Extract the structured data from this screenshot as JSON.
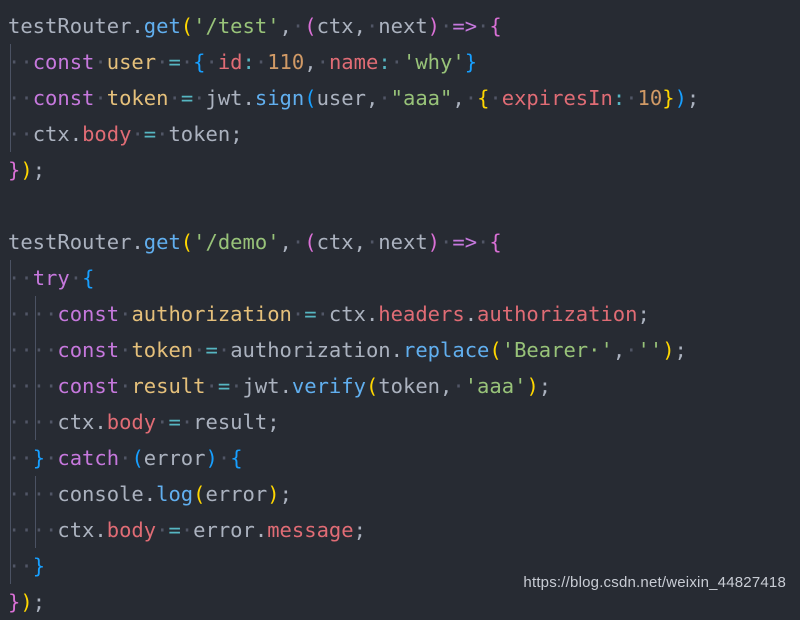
{
  "editor": {
    "background": "#272b33",
    "foreground": "#abb2bf",
    "language": "javascript",
    "indent_guide_color": "#4b5263",
    "whitespace_dot_color": "#515666"
  },
  "colors": {
    "keyword": "#c678dd",
    "function": "#61afef",
    "property": "#e06c75",
    "string": "#98c379",
    "number": "#d19a66",
    "variable_def": "#e5c07b",
    "operator": "#56b6c2",
    "bracket_gold": "#ffd700",
    "bracket_magenta": "#da70d6",
    "bracket_blue": "#179fff"
  },
  "watermark": {
    "text": "https://blog.csdn.net/weixin_44827418"
  },
  "code": {
    "lines": [
      {
        "index": 1,
        "text": "testRouter.get('/test', (ctx, next) => {",
        "tokens": [
          {
            "t": "testRouter",
            "c": "t-var"
          },
          {
            "t": ".",
            "c": "t-punct"
          },
          {
            "t": "get",
            "c": "t-fn"
          },
          {
            "t": "(",
            "c": "by"
          },
          {
            "t": "'/test'",
            "c": "t-str"
          },
          {
            "t": ",",
            "c": "t-punct"
          },
          {
            "t": "·",
            "c": "ws"
          },
          {
            "t": "(",
            "c": "bm"
          },
          {
            "t": "ctx",
            "c": "t-var"
          },
          {
            "t": ",",
            "c": "t-punct"
          },
          {
            "t": "·",
            "c": "ws"
          },
          {
            "t": "next",
            "c": "t-var"
          },
          {
            "t": ")",
            "c": "bm"
          },
          {
            "t": "·",
            "c": "ws"
          },
          {
            "t": "=>",
            "c": "t-arrow"
          },
          {
            "t": "·",
            "c": "ws"
          },
          {
            "t": "{",
            "c": "bm"
          }
        ]
      },
      {
        "index": 2,
        "text": "  const user = { id: 110, name: 'why'}",
        "tokens": [
          {
            "t": "·",
            "c": "ws"
          },
          {
            "t": "·",
            "c": "ws"
          },
          {
            "t": "const",
            "c": "t-kw"
          },
          {
            "t": "·",
            "c": "ws"
          },
          {
            "t": "user",
            "c": "t-def"
          },
          {
            "t": "·",
            "c": "ws"
          },
          {
            "t": "=",
            "c": "t-op"
          },
          {
            "t": "·",
            "c": "ws"
          },
          {
            "t": "{",
            "c": "bb"
          },
          {
            "t": "·",
            "c": "ws"
          },
          {
            "t": "id",
            "c": "t-prop"
          },
          {
            "t": ":",
            "c": "t-op"
          },
          {
            "t": "·",
            "c": "ws"
          },
          {
            "t": "110",
            "c": "t-num"
          },
          {
            "t": ",",
            "c": "t-punct"
          },
          {
            "t": "·",
            "c": "ws"
          },
          {
            "t": "name",
            "c": "t-prop"
          },
          {
            "t": ":",
            "c": "t-op"
          },
          {
            "t": "·",
            "c": "ws"
          },
          {
            "t": "'why'",
            "c": "t-str"
          },
          {
            "t": "}",
            "c": "bb"
          }
        ]
      },
      {
        "index": 3,
        "text": "  const token = jwt.sign(user, \"aaa\", { expiresIn: 10});",
        "tokens": [
          {
            "t": "·",
            "c": "ws"
          },
          {
            "t": "·",
            "c": "ws"
          },
          {
            "t": "const",
            "c": "t-kw"
          },
          {
            "t": "·",
            "c": "ws"
          },
          {
            "t": "token",
            "c": "t-def"
          },
          {
            "t": "·",
            "c": "ws"
          },
          {
            "t": "=",
            "c": "t-op"
          },
          {
            "t": "·",
            "c": "ws"
          },
          {
            "t": "jwt",
            "c": "t-var"
          },
          {
            "t": ".",
            "c": "t-punct"
          },
          {
            "t": "sign",
            "c": "t-fn"
          },
          {
            "t": "(",
            "c": "bb"
          },
          {
            "t": "user",
            "c": "t-var"
          },
          {
            "t": ",",
            "c": "t-punct"
          },
          {
            "t": "·",
            "c": "ws"
          },
          {
            "t": "\"aaa\"",
            "c": "t-str"
          },
          {
            "t": ",",
            "c": "t-punct"
          },
          {
            "t": "·",
            "c": "ws"
          },
          {
            "t": "{",
            "c": "by"
          },
          {
            "t": "·",
            "c": "ws"
          },
          {
            "t": "expiresIn",
            "c": "t-prop"
          },
          {
            "t": ":",
            "c": "t-op"
          },
          {
            "t": "·",
            "c": "ws"
          },
          {
            "t": "10",
            "c": "t-num"
          },
          {
            "t": "}",
            "c": "by"
          },
          {
            "t": ")",
            "c": "bb"
          },
          {
            "t": ";",
            "c": "t-punct"
          }
        ]
      },
      {
        "index": 4,
        "text": "  ctx.body = token;",
        "tokens": [
          {
            "t": "·",
            "c": "ws"
          },
          {
            "t": "·",
            "c": "ws"
          },
          {
            "t": "ctx",
            "c": "t-var"
          },
          {
            "t": ".",
            "c": "t-punct"
          },
          {
            "t": "body",
            "c": "t-prop"
          },
          {
            "t": "·",
            "c": "ws"
          },
          {
            "t": "=",
            "c": "t-op"
          },
          {
            "t": "·",
            "c": "ws"
          },
          {
            "t": "token",
            "c": "t-var"
          },
          {
            "t": ";",
            "c": "t-punct"
          }
        ]
      },
      {
        "index": 5,
        "text": "});",
        "tokens": [
          {
            "t": "}",
            "c": "bm"
          },
          {
            "t": ")",
            "c": "by"
          },
          {
            "t": ";",
            "c": "t-punct"
          }
        ]
      },
      {
        "index": 6,
        "text": "",
        "tokens": []
      },
      {
        "index": 7,
        "text": "testRouter.get('/demo', (ctx, next) => {",
        "tokens": [
          {
            "t": "testRouter",
            "c": "t-var"
          },
          {
            "t": ".",
            "c": "t-punct"
          },
          {
            "t": "get",
            "c": "t-fn"
          },
          {
            "t": "(",
            "c": "by"
          },
          {
            "t": "'/demo'",
            "c": "t-str"
          },
          {
            "t": ",",
            "c": "t-punct"
          },
          {
            "t": "·",
            "c": "ws"
          },
          {
            "t": "(",
            "c": "bm"
          },
          {
            "t": "ctx",
            "c": "t-var"
          },
          {
            "t": ",",
            "c": "t-punct"
          },
          {
            "t": "·",
            "c": "ws"
          },
          {
            "t": "next",
            "c": "t-var"
          },
          {
            "t": ")",
            "c": "bm"
          },
          {
            "t": "·",
            "c": "ws"
          },
          {
            "t": "=>",
            "c": "t-arrow"
          },
          {
            "t": "·",
            "c": "ws"
          },
          {
            "t": "{",
            "c": "bm"
          }
        ]
      },
      {
        "index": 8,
        "text": "  try {",
        "tokens": [
          {
            "t": "·",
            "c": "ws"
          },
          {
            "t": "·",
            "c": "ws"
          },
          {
            "t": "try",
            "c": "t-kw"
          },
          {
            "t": "·",
            "c": "ws"
          },
          {
            "t": "{",
            "c": "bb"
          }
        ]
      },
      {
        "index": 9,
        "text": "    const authorization = ctx.headers.authorization;",
        "tokens": [
          {
            "t": "·",
            "c": "ws"
          },
          {
            "t": "·",
            "c": "ws"
          },
          {
            "t": "·",
            "c": "ws"
          },
          {
            "t": "·",
            "c": "ws"
          },
          {
            "t": "const",
            "c": "t-kw"
          },
          {
            "t": "·",
            "c": "ws"
          },
          {
            "t": "authorization",
            "c": "t-def"
          },
          {
            "t": "·",
            "c": "ws"
          },
          {
            "t": "=",
            "c": "t-op"
          },
          {
            "t": "·",
            "c": "ws"
          },
          {
            "t": "ctx",
            "c": "t-var"
          },
          {
            "t": ".",
            "c": "t-punct"
          },
          {
            "t": "headers",
            "c": "t-prop"
          },
          {
            "t": ".",
            "c": "t-punct"
          },
          {
            "t": "authorization",
            "c": "t-prop"
          },
          {
            "t": ";",
            "c": "t-punct"
          }
        ]
      },
      {
        "index": 10,
        "text": "    const token = authorization.replace('Bearer ', '');",
        "tokens": [
          {
            "t": "·",
            "c": "ws"
          },
          {
            "t": "·",
            "c": "ws"
          },
          {
            "t": "·",
            "c": "ws"
          },
          {
            "t": "·",
            "c": "ws"
          },
          {
            "t": "const",
            "c": "t-kw"
          },
          {
            "t": "·",
            "c": "ws"
          },
          {
            "t": "token",
            "c": "t-def"
          },
          {
            "t": "·",
            "c": "ws"
          },
          {
            "t": "=",
            "c": "t-op"
          },
          {
            "t": "·",
            "c": "ws"
          },
          {
            "t": "authorization",
            "c": "t-var"
          },
          {
            "t": ".",
            "c": "t-punct"
          },
          {
            "t": "replace",
            "c": "t-fn"
          },
          {
            "t": "(",
            "c": "by"
          },
          {
            "t": "'Bearer·'",
            "c": "t-str"
          },
          {
            "t": ",",
            "c": "t-punct"
          },
          {
            "t": "·",
            "c": "ws"
          },
          {
            "t": "''",
            "c": "t-str"
          },
          {
            "t": ")",
            "c": "by"
          },
          {
            "t": ";",
            "c": "t-punct"
          }
        ]
      },
      {
        "index": 11,
        "text": "    const result = jwt.verify(token, 'aaa');",
        "tokens": [
          {
            "t": "·",
            "c": "ws"
          },
          {
            "t": "·",
            "c": "ws"
          },
          {
            "t": "·",
            "c": "ws"
          },
          {
            "t": "·",
            "c": "ws"
          },
          {
            "t": "const",
            "c": "t-kw"
          },
          {
            "t": "·",
            "c": "ws"
          },
          {
            "t": "result",
            "c": "t-def"
          },
          {
            "t": "·",
            "c": "ws"
          },
          {
            "t": "=",
            "c": "t-op"
          },
          {
            "t": "·",
            "c": "ws"
          },
          {
            "t": "jwt",
            "c": "t-var"
          },
          {
            "t": ".",
            "c": "t-punct"
          },
          {
            "t": "verify",
            "c": "t-fn"
          },
          {
            "t": "(",
            "c": "by"
          },
          {
            "t": "token",
            "c": "t-var"
          },
          {
            "t": ",",
            "c": "t-punct"
          },
          {
            "t": "·",
            "c": "ws"
          },
          {
            "t": "'aaa'",
            "c": "t-str"
          },
          {
            "t": ")",
            "c": "by"
          },
          {
            "t": ";",
            "c": "t-punct"
          }
        ]
      },
      {
        "index": 12,
        "text": "    ctx.body = result;",
        "tokens": [
          {
            "t": "·",
            "c": "ws"
          },
          {
            "t": "·",
            "c": "ws"
          },
          {
            "t": "·",
            "c": "ws"
          },
          {
            "t": "·",
            "c": "ws"
          },
          {
            "t": "ctx",
            "c": "t-var"
          },
          {
            "t": ".",
            "c": "t-punct"
          },
          {
            "t": "body",
            "c": "t-prop"
          },
          {
            "t": "·",
            "c": "ws"
          },
          {
            "t": "=",
            "c": "t-op"
          },
          {
            "t": "·",
            "c": "ws"
          },
          {
            "t": "result",
            "c": "t-var"
          },
          {
            "t": ";",
            "c": "t-punct"
          }
        ]
      },
      {
        "index": 13,
        "text": "  } catch (error) {",
        "tokens": [
          {
            "t": "·",
            "c": "ws"
          },
          {
            "t": "·",
            "c": "ws"
          },
          {
            "t": "}",
            "c": "bb"
          },
          {
            "t": "·",
            "c": "ws"
          },
          {
            "t": "catch",
            "c": "t-kw"
          },
          {
            "t": "·",
            "c": "ws"
          },
          {
            "t": "(",
            "c": "bb"
          },
          {
            "t": "error",
            "c": "t-var"
          },
          {
            "t": ")",
            "c": "bb"
          },
          {
            "t": "·",
            "c": "ws"
          },
          {
            "t": "{",
            "c": "bb"
          }
        ]
      },
      {
        "index": 14,
        "text": "    console.log(error);",
        "tokens": [
          {
            "t": "·",
            "c": "ws"
          },
          {
            "t": "·",
            "c": "ws"
          },
          {
            "t": "·",
            "c": "ws"
          },
          {
            "t": "·",
            "c": "ws"
          },
          {
            "t": "console",
            "c": "t-var"
          },
          {
            "t": ".",
            "c": "t-punct"
          },
          {
            "t": "log",
            "c": "t-fn"
          },
          {
            "t": "(",
            "c": "by"
          },
          {
            "t": "error",
            "c": "t-var"
          },
          {
            "t": ")",
            "c": "by"
          },
          {
            "t": ";",
            "c": "t-punct"
          }
        ]
      },
      {
        "index": 15,
        "text": "    ctx.body = error.message;",
        "tokens": [
          {
            "t": "·",
            "c": "ws"
          },
          {
            "t": "·",
            "c": "ws"
          },
          {
            "t": "·",
            "c": "ws"
          },
          {
            "t": "·",
            "c": "ws"
          },
          {
            "t": "ctx",
            "c": "t-var"
          },
          {
            "t": ".",
            "c": "t-punct"
          },
          {
            "t": "body",
            "c": "t-prop"
          },
          {
            "t": "·",
            "c": "ws"
          },
          {
            "t": "=",
            "c": "t-op"
          },
          {
            "t": "·",
            "c": "ws"
          },
          {
            "t": "error",
            "c": "t-var"
          },
          {
            "t": ".",
            "c": "t-punct"
          },
          {
            "t": "message",
            "c": "t-prop"
          },
          {
            "t": ";",
            "c": "t-punct"
          }
        ]
      },
      {
        "index": 16,
        "text": "  }",
        "tokens": [
          {
            "t": "·",
            "c": "ws"
          },
          {
            "t": "·",
            "c": "ws"
          },
          {
            "t": "}",
            "c": "bb"
          }
        ]
      },
      {
        "index": 17,
        "text": "});",
        "tokens": [
          {
            "t": "}",
            "c": "bm"
          },
          {
            "t": ")",
            "c": "by"
          },
          {
            "t": ";",
            "c": "t-punct"
          }
        ]
      }
    ],
    "guides": {
      "1": [],
      "2": [
        1
      ],
      "3": [
        1
      ],
      "4": [
        1
      ],
      "5": [],
      "6": [],
      "7": [],
      "8": [
        1
      ],
      "9": [
        1,
        2
      ],
      "10": [
        1,
        2
      ],
      "11": [
        1,
        2
      ],
      "12": [
        1,
        2
      ],
      "13": [
        1
      ],
      "14": [
        1,
        2
      ],
      "15": [
        1,
        2
      ],
      "16": [
        1
      ],
      "17": []
    }
  }
}
